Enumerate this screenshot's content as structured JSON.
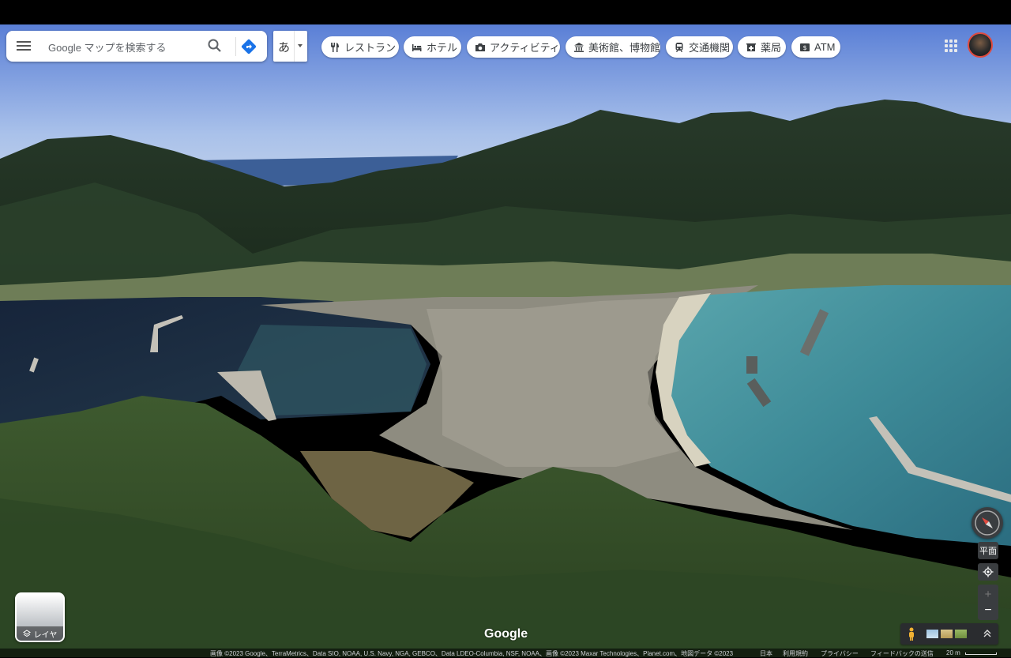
{
  "search": {
    "placeholder": "Google マップを検索する"
  },
  "ime": {
    "char": "あ"
  },
  "chips": [
    {
      "label": "レストラン",
      "icon": "fork-knife-icon"
    },
    {
      "label": "ホテル",
      "icon": "bed-icon"
    },
    {
      "label": "アクティビティ",
      "icon": "camera-icon"
    },
    {
      "label": "美術館、博物館",
      "icon": "museum-icon"
    },
    {
      "label": "交通機関",
      "icon": "train-icon"
    },
    {
      "label": "薬局",
      "icon": "pharmacy-icon"
    },
    {
      "label": "ATM",
      "icon": "atm-icon"
    }
  ],
  "map": {
    "logo": "Google",
    "layer_label": "レイヤ",
    "tilt_label": "平面",
    "scale": "20 m"
  },
  "attribution": {
    "imagery": "画像 ©2023 Google、TerraMetrics、Data SIO, NOAA, U.S. Navy, NGA, GEBCO、Data LDEO-Columbia, NSF, NOAA、画像 ©2023 Maxar Technologies、Planet.com、地図データ ©2023",
    "country": "日本",
    "terms": "利用規約",
    "privacy": "プライバシー",
    "feedback": "フィードバックの送信"
  }
}
